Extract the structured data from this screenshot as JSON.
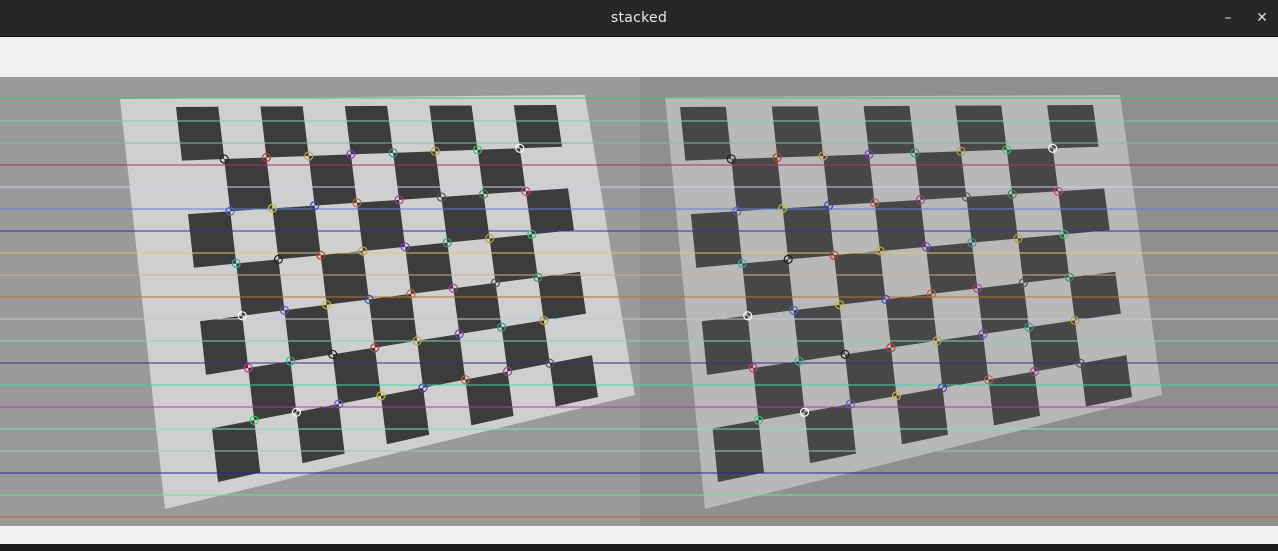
{
  "window": {
    "title": "stacked",
    "minimize_symbol": "–",
    "close_symbol": "✕"
  },
  "image": {
    "description_tag": "stereo-rectified-checkerboard-pair",
    "epipolar_line_colors": [
      "#2ecc71",
      "#7fd1a8",
      "#6ad07a",
      "#b0306a",
      "#c8d4e8",
      "#5e7fd0",
      "#2832b8",
      "#d4c87a",
      "#c8b08a",
      "#b07a2a",
      "#a8d0f0",
      "#8ad0b0",
      "#30308a",
      "#4ad0b0",
      "#c030b8",
      "#8ad8b8",
      "#a0c8a8",
      "#202898",
      "#70e080",
      "#d05a30"
    ],
    "corner_colors": [
      "#222",
      "#c0392b",
      "#c9a14a",
      "#7d3cc8",
      "#2a9d8f",
      "#b8a030",
      "#2ecc71",
      "#ffffff",
      "#5a5ad0",
      "#c8c020",
      "#4040c0",
      "#c06040",
      "#a04090",
      "#555",
      "#3a9060",
      "#e03090",
      "#2ab0a0"
    ]
  }
}
